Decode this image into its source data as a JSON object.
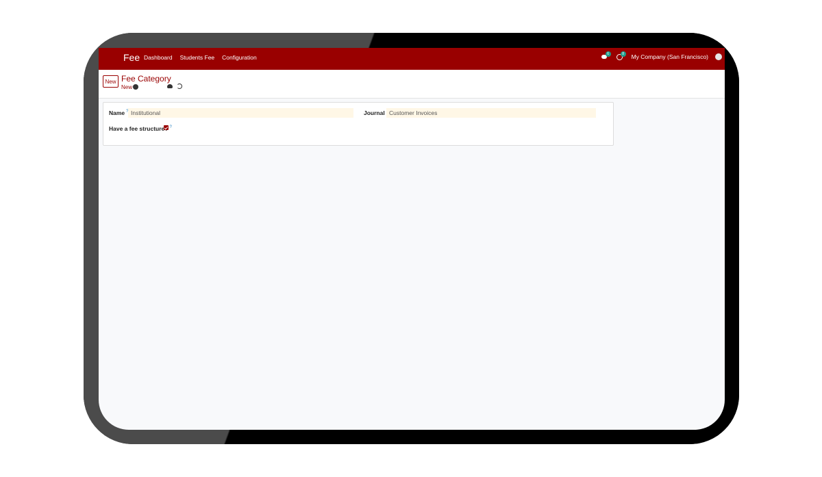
{
  "navbar": {
    "app_name": "Fee",
    "menu": [
      "Dashboard",
      "Students Fee",
      "Configuration"
    ],
    "chat_badge": "6",
    "activity_badge": "8",
    "company": "My Company (San Francisco)"
  },
  "control_panel": {
    "new_button": "New",
    "breadcrumb_title": "Fee Category",
    "breadcrumb_sub": "New"
  },
  "form": {
    "name_label": "Name",
    "name_value": "Institutional",
    "journal_label": "Journal",
    "journal_value": "Customer Invoices",
    "fee_structure_label": "Have a fee structure?",
    "fee_structure_checked": true,
    "help_mark": "?"
  },
  "colors": {
    "brand": "#990000",
    "badge": "#1e9c8c",
    "field_bg": "#fff7e6"
  }
}
